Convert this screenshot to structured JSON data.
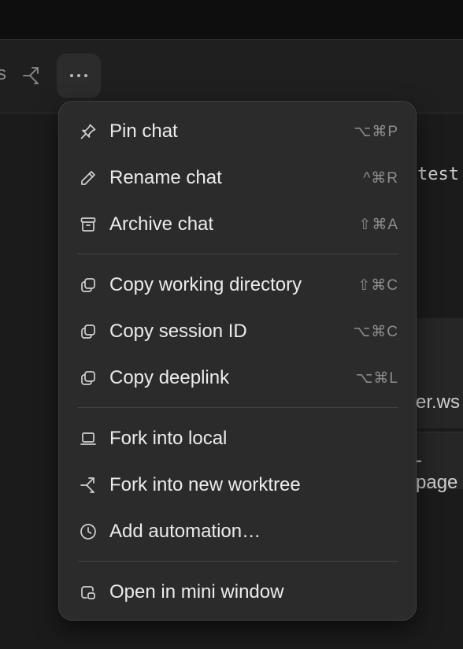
{
  "toolbar": {
    "fragment_text": "s",
    "icons": {
      "fork": "fork-arrow-icon",
      "more": "more-horizontal-icon"
    }
  },
  "background": {
    "text_1": "test",
    "text_2": "er.ws",
    "text_3": "-page"
  },
  "menu": {
    "groups": [
      {
        "items": [
          {
            "label": "Pin chat",
            "shortcut": "⌥⌘P",
            "icon": "pin-icon"
          },
          {
            "label": "Rename chat",
            "shortcut": "^⌘R",
            "icon": "pencil-icon"
          },
          {
            "label": "Archive chat",
            "shortcut": "⇧⌘A",
            "icon": "archive-icon"
          }
        ]
      },
      {
        "items": [
          {
            "label": "Copy working directory",
            "shortcut": "⇧⌘C",
            "icon": "copy-icon"
          },
          {
            "label": "Copy session ID",
            "shortcut": "⌥⌘C",
            "icon": "copy-icon"
          },
          {
            "label": "Copy deeplink",
            "shortcut": "⌥⌘L",
            "icon": "copy-icon"
          }
        ]
      },
      {
        "items": [
          {
            "label": "Fork into local",
            "shortcut": "",
            "icon": "laptop-icon"
          },
          {
            "label": "Fork into new worktree",
            "shortcut": "",
            "icon": "fork-arrow-icon"
          },
          {
            "label": "Add automation…",
            "shortcut": "",
            "icon": "clock-icon"
          }
        ]
      },
      {
        "items": [
          {
            "label": "Open in mini window",
            "shortcut": "",
            "icon": "mini-window-icon"
          }
        ]
      }
    ]
  }
}
